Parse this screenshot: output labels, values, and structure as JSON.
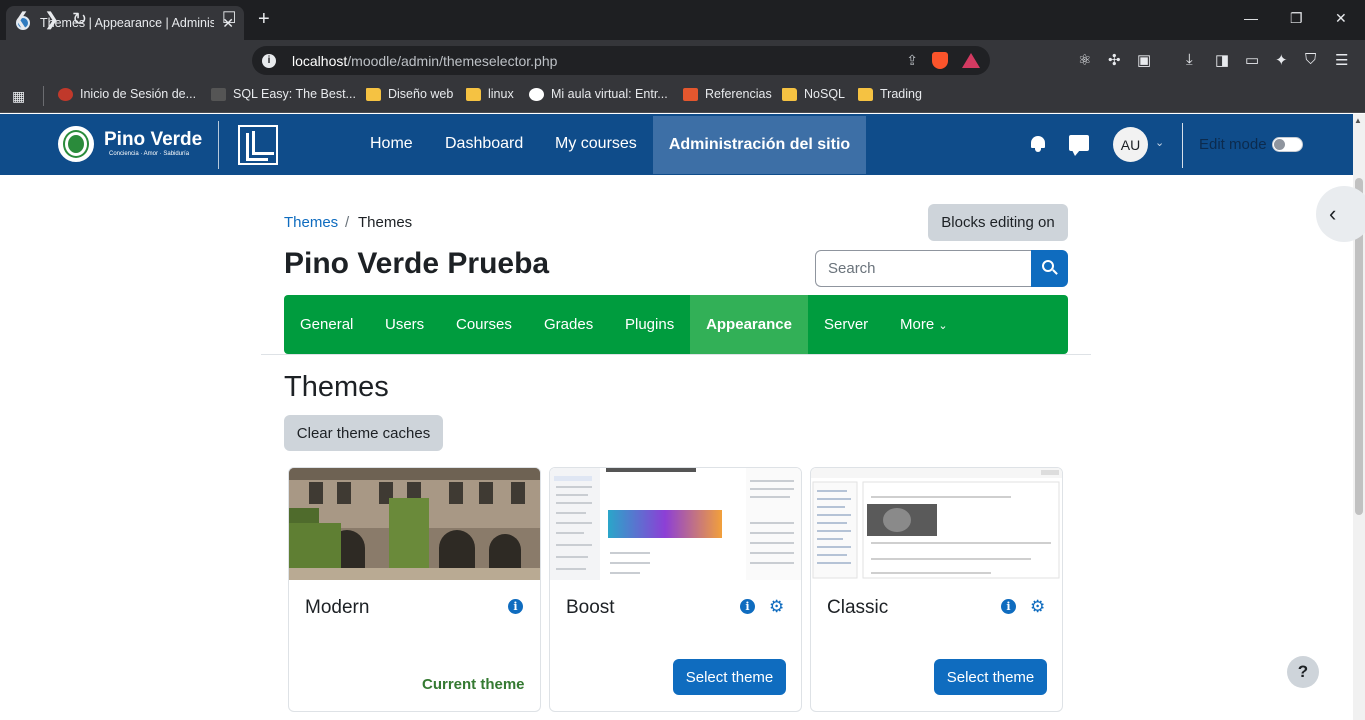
{
  "browser": {
    "tab_title": "Themes | Appearance | Administr",
    "url_host": "localhost",
    "url_path": "/moodle/admin/themeselector.php",
    "bookmarks": [
      {
        "label": "Inicio de Sesión de..."
      },
      {
        "label": "SQL Easy: The Best..."
      },
      {
        "label": "Diseño web"
      },
      {
        "label": "linux"
      },
      {
        "label": "Mi aula virtual: Entr..."
      },
      {
        "label": "Referencias"
      },
      {
        "label": "NoSQL"
      },
      {
        "label": "Trading"
      }
    ]
  },
  "header": {
    "logo_name": "Pino Verde",
    "logo_tagline": "Conciencia · Amor · Sabiduría",
    "nav": [
      "Home",
      "Dashboard",
      "My courses",
      "Administración del sitio"
    ],
    "avatar_initials": "AU",
    "edit_mode_label": "Edit mode"
  },
  "breadcrumb": {
    "link": "Themes",
    "separator": "/",
    "current": "Themes"
  },
  "blocks_editing_label": "Blocks editing on",
  "site_title": "Pino Verde Prueba",
  "search": {
    "placeholder": "Search"
  },
  "secondary_nav": [
    "General",
    "Users",
    "Courses",
    "Grades",
    "Plugins",
    "Appearance",
    "Server",
    "More"
  ],
  "page_heading": "Themes",
  "clear_caches_label": "Clear theme caches",
  "themes": [
    {
      "name": "Modern",
      "status": "Current theme"
    },
    {
      "name": "Boost",
      "button": "Select theme"
    },
    {
      "name": "Classic",
      "button": "Select theme"
    }
  ],
  "help_label": "?",
  "colors": {
    "header_blue": "#0f4c8a",
    "nav_green": "#009c3e",
    "primary": "#0f6cbf"
  }
}
